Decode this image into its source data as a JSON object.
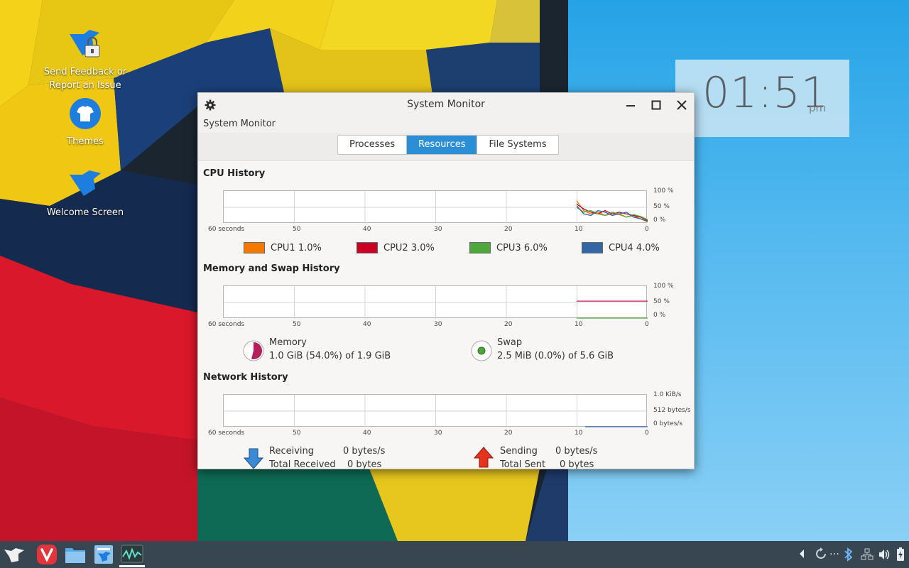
{
  "desktop": {
    "icons": [
      {
        "label": "Send Feedback or Report an Issue"
      },
      {
        "label": "Themes"
      },
      {
        "label": "Welcome Screen"
      }
    ]
  },
  "clock": {
    "time": "01:51",
    "ampm": "pm"
  },
  "window": {
    "title": "System Monitor",
    "menu_label": "System Monitor",
    "tabs": [
      {
        "label": "Processes",
        "active": false
      },
      {
        "label": "Resources",
        "active": true
      },
      {
        "label": "File Systems",
        "active": false
      }
    ]
  },
  "cpu": {
    "title": "CPU History",
    "x_labels": [
      "60 seconds",
      "50",
      "40",
      "30",
      "20",
      "10",
      "0"
    ],
    "y_labels": [
      "100 %",
      "50 %",
      "0 %"
    ],
    "cores": [
      {
        "name": "CPU1",
        "value": "1.0%",
        "color": "#f57900"
      },
      {
        "name": "CPU2",
        "value": "3.0%",
        "color": "#cc0022"
      },
      {
        "name": "CPU3",
        "value": "6.0%",
        "color": "#4ea73a"
      },
      {
        "name": "CPU4",
        "value": "4.0%",
        "color": "#3465a4"
      }
    ]
  },
  "memory": {
    "title": "Memory and Swap History",
    "x_labels": [
      "60 seconds",
      "50",
      "40",
      "30",
      "20",
      "10",
      "0"
    ],
    "y_labels": [
      "100 %",
      "50 %",
      "0 %"
    ],
    "memory_label": "Memory",
    "memory_value": "1.0 GiB (54.0%) of 1.9 GiB",
    "memory_color": "#b5205a",
    "swap_label": "Swap",
    "swap_value": "2.5 MiB (0.0%) of 5.6 GiB",
    "swap_color": "#4ea73a"
  },
  "network": {
    "title": "Network History",
    "x_labels": [
      "60 seconds",
      "50",
      "40",
      "30",
      "20",
      "10",
      "0"
    ],
    "y_labels": [
      "1.0 KiB/s",
      "512 bytes/s",
      "0 bytes/s"
    ],
    "receiving_label": "Receiving",
    "receiving_value": "0 bytes/s",
    "total_received_label": "Total Received",
    "total_received_value": "0 bytes",
    "sending_label": "Sending",
    "sending_value": "0 bytes/s",
    "total_sent_label": "Total Sent",
    "total_sent_value": "0 bytes"
  },
  "taskbar": {
    "tray_ellipsis": "…"
  }
}
